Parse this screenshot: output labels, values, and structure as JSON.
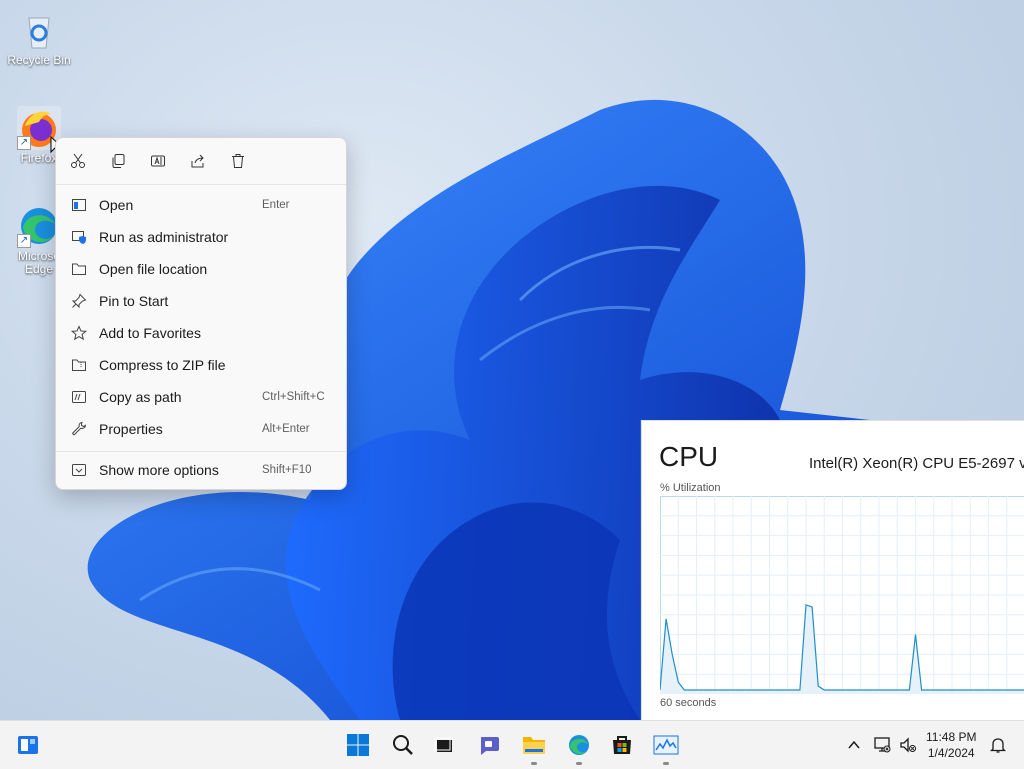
{
  "desktop": {
    "icons": [
      {
        "label": "Recycle Bin",
        "icon": "recycle-bin-icon"
      },
      {
        "label": "Firefox",
        "icon": "firefox-icon"
      },
      {
        "label": "Microsoft Edge",
        "label_line1": "Microso",
        "label_line2": "Edge",
        "icon": "edge-icon"
      }
    ]
  },
  "context_menu": {
    "quick_actions": [
      {
        "name": "cut",
        "icon": "scissors-icon"
      },
      {
        "name": "copy",
        "icon": "copy-icon"
      },
      {
        "name": "rename",
        "icon": "rename-icon"
      },
      {
        "name": "share",
        "icon": "share-icon"
      },
      {
        "name": "delete",
        "icon": "trash-icon"
      }
    ],
    "items": [
      {
        "label": "Open",
        "shortcut": "Enter",
        "icon": "open-icon"
      },
      {
        "label": "Run as administrator",
        "shortcut": "",
        "icon": "shield-icon"
      },
      {
        "label": "Open file location",
        "shortcut": "",
        "icon": "folder-icon"
      },
      {
        "label": "Pin to Start",
        "shortcut": "",
        "icon": "pin-icon"
      },
      {
        "label": "Add to Favorites",
        "shortcut": "",
        "icon": "star-icon"
      },
      {
        "label": "Compress to ZIP file",
        "shortcut": "",
        "icon": "zip-folder-icon"
      },
      {
        "label": "Copy as path",
        "shortcut": "Ctrl+Shift+C",
        "icon": "copy-path-icon"
      },
      {
        "label": "Properties",
        "shortcut": "Alt+Enter",
        "icon": "wrench-icon"
      },
      {
        "label": "Show more options",
        "shortcut": "Shift+F10",
        "icon": "more-options-icon"
      }
    ]
  },
  "task_manager": {
    "title": "CPU",
    "cpu_name": "Intel(R) Xeon(R) CPU E5-2697 v",
    "y_label": "% Utilization",
    "x_label": "60 seconds",
    "chart_data": {
      "type": "area",
      "title": "",
      "xlabel": "60 seconds",
      "ylabel": "% Utilization",
      "ylim": [
        0,
        100
      ],
      "x": [
        0,
        1,
        2,
        3,
        4,
        5,
        6,
        7,
        8,
        9,
        10,
        11,
        12,
        13,
        14,
        15,
        16,
        17,
        18,
        19,
        20,
        21,
        22,
        23,
        24,
        25,
        26,
        27,
        28,
        29,
        30,
        31,
        32,
        33,
        34,
        35,
        36,
        37,
        38,
        39,
        40,
        41,
        42,
        43,
        44,
        45,
        46,
        47,
        48,
        49,
        50,
        51,
        52,
        53,
        54,
        55,
        56,
        57,
        58,
        59,
        60
      ],
      "values": [
        2,
        38,
        20,
        6,
        2,
        2,
        2,
        2,
        2,
        2,
        2,
        2,
        2,
        2,
        2,
        2,
        2,
        2,
        2,
        2,
        2,
        2,
        2,
        2,
        45,
        44,
        4,
        2,
        2,
        2,
        2,
        2,
        2,
        2,
        2,
        2,
        2,
        2,
        2,
        2,
        2,
        2,
        30,
        2,
        2,
        2,
        2,
        2,
        2,
        2,
        2,
        2,
        2,
        2,
        2,
        2,
        2,
        2,
        2,
        2,
        2
      ],
      "grid": true,
      "color": "#1f8fc9"
    }
  },
  "taskbar": {
    "buttons": [
      {
        "name": "widgets",
        "icon": "widgets-icon"
      },
      {
        "name": "start",
        "icon": "windows-start-icon"
      },
      {
        "name": "search",
        "icon": "search-icon"
      },
      {
        "name": "task-view",
        "icon": "task-view-icon"
      },
      {
        "name": "chat",
        "icon": "chat-icon"
      },
      {
        "name": "file-explorer",
        "icon": "folder-icon"
      },
      {
        "name": "edge",
        "icon": "edge-icon"
      },
      {
        "name": "store",
        "icon": "store-icon"
      },
      {
        "name": "task-manager",
        "icon": "task-manager-icon"
      }
    ],
    "tray": [
      "chevron-up-icon",
      "network-icon",
      "volume-muted-icon",
      "notification-icon"
    ],
    "time": "11:48 PM",
    "date": "1/4/2024"
  },
  "colors": {
    "accent": "#0067c0",
    "graph_line": "#1f8fc9",
    "graph_fill": "#e6f1f9"
  }
}
